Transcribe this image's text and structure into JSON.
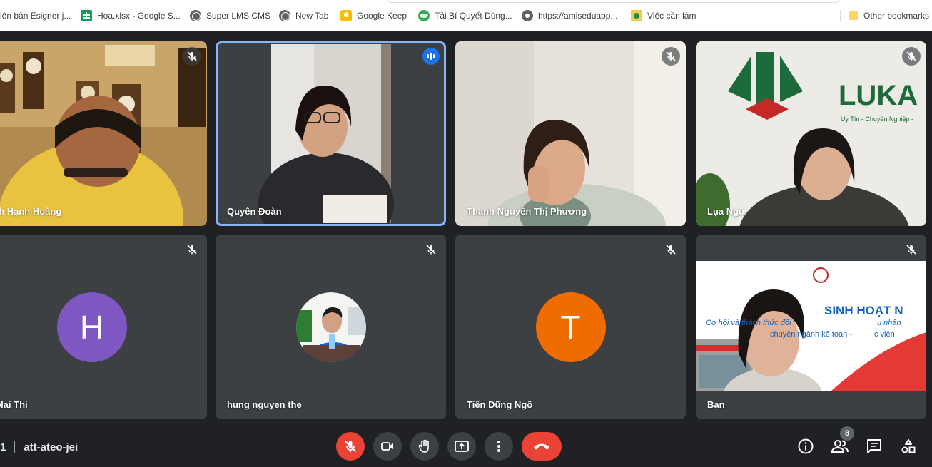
{
  "bookmarks": [
    {
      "label": "iên bản Esigner j...",
      "icon": "pdf-icon"
    },
    {
      "label": "Hoa.xlsx - Google S...",
      "icon": "sheets-icon"
    },
    {
      "label": "Super LMS CMS",
      "icon": "globe-icon"
    },
    {
      "label": "New Tab",
      "icon": "globe-icon"
    },
    {
      "label": "Google Keep",
      "icon": "keep-icon"
    },
    {
      "label": "Tải Bí Quyết Dùng...",
      "icon": "leaf-icon"
    },
    {
      "label": "https://amiseduapp...",
      "icon": "gear-icon"
    },
    {
      "label": "Việc cần làm",
      "icon": "task-icon"
    }
  ],
  "other_bookmarks": "Other bookmarks",
  "participants": [
    {
      "name": "anh Hạnh Hoàng",
      "muted": true
    },
    {
      "name": "Quyên Đoàn",
      "muted": false,
      "speaking": true
    },
    {
      "name": "Thanh Nguyễn Thị Phương",
      "muted": true
    },
    {
      "name": "Lụa Ngô",
      "muted": true
    },
    {
      "name": "a Mai Thị",
      "muted": true,
      "initial": "H",
      "avatar_color": "#7e57c2"
    },
    {
      "name": "hung nguyen the",
      "muted": true
    },
    {
      "name": "Tiến Dũng Ngô",
      "muted": true,
      "initial": "T",
      "avatar_color": "#ef6c00"
    },
    {
      "name": "Bạn",
      "muted": true
    }
  ],
  "backgrounds": {
    "logo_text": "LUKA",
    "logo_tagline": "Uy Tín - Chuyên Nghiệp -",
    "slide_title": "SINH HOẠT N",
    "slide_line1": "Cơ hội và thách thức đối",
    "slide_line1b": "u nhân",
    "slide_line2": "chuyên ngành kế toán -",
    "slide_line2b": "c viện"
  },
  "meeting": {
    "time_fragment": "1",
    "code": "att-ateo-jei"
  },
  "people_count": "8",
  "colors": {
    "background": "#202124",
    "tile": "#3c4043",
    "accent_blue": "#1a73e8",
    "active_outline": "#8ab4f8",
    "danger": "#ea4335"
  }
}
